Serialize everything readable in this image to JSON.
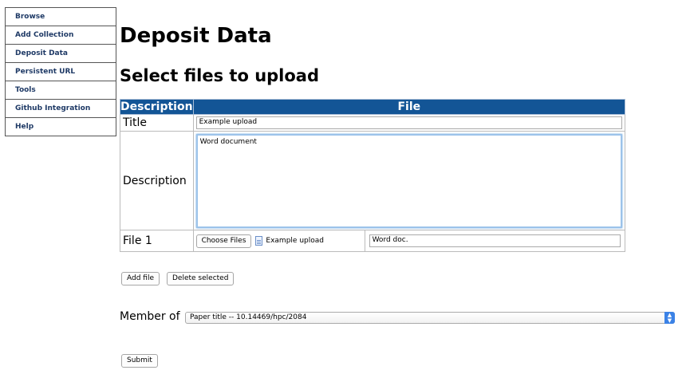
{
  "sidebar": {
    "items": [
      {
        "label": "Browse"
      },
      {
        "label": "Add Collection"
      },
      {
        "label": "Deposit Data"
      },
      {
        "label": "Persistent URL"
      },
      {
        "label": "Tools"
      },
      {
        "label": "Github Integration"
      },
      {
        "label": "Help"
      }
    ]
  },
  "page": {
    "title": "Deposit Data",
    "section_title": "Select files to upload"
  },
  "table": {
    "headers": {
      "description": "Description",
      "file": "File"
    },
    "rows": {
      "title_label": "Title",
      "title_value": "Example upload",
      "description_label": "Description",
      "description_value": "Word document",
      "file_label": "File 1",
      "choose_files_label": "Choose Files",
      "chosen_file_name": "Example upload",
      "file_description_value": "Word doc."
    }
  },
  "actions": {
    "add_file_label": "Add file",
    "delete_selected_label": "Delete selected",
    "submit_label": "Submit"
  },
  "member_of": {
    "label": "Member of",
    "selected": "Paper title -- 10.14469/hpc/2084"
  },
  "colors": {
    "header_bg": "#135596",
    "sidebar_text": "#1f3a66",
    "select_arrow": "#3b82e6"
  }
}
